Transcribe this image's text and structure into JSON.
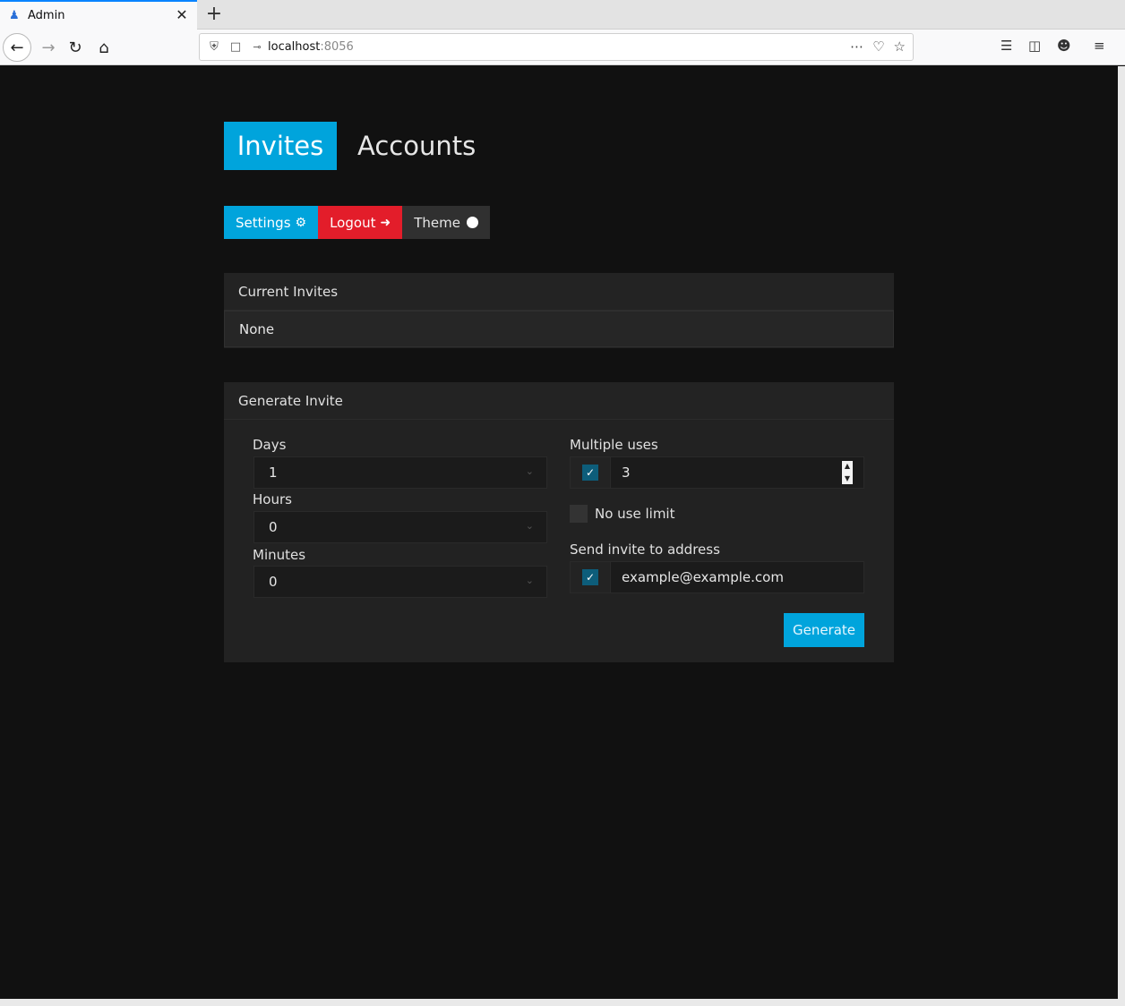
{
  "browser": {
    "tab_title": "Admin",
    "url_host": "localhost",
    "url_port": ":8056"
  },
  "nav": {
    "tabs": [
      {
        "label": "Invites"
      },
      {
        "label": "Accounts"
      }
    ]
  },
  "toolbar": {
    "settings_label": "Settings",
    "logout_label": "Logout",
    "theme_label": "Theme"
  },
  "current_invites": {
    "title": "Current Invites",
    "empty_text": "None"
  },
  "generate": {
    "title": "Generate Invite",
    "days_label": "Days",
    "days_value": "1",
    "hours_label": "Hours",
    "hours_value": "0",
    "minutes_label": "Minutes",
    "minutes_value": "0",
    "multiple_uses_label": "Multiple uses",
    "multiple_uses_value": "3",
    "no_limit_label": "No use limit",
    "send_label": "Send invite to address",
    "email_value": "example@example.com",
    "button_label": "Generate"
  },
  "colors": {
    "accent": "#00a4dc",
    "danger": "#e31d2a",
    "background": "#111111",
    "card": "#222222"
  }
}
